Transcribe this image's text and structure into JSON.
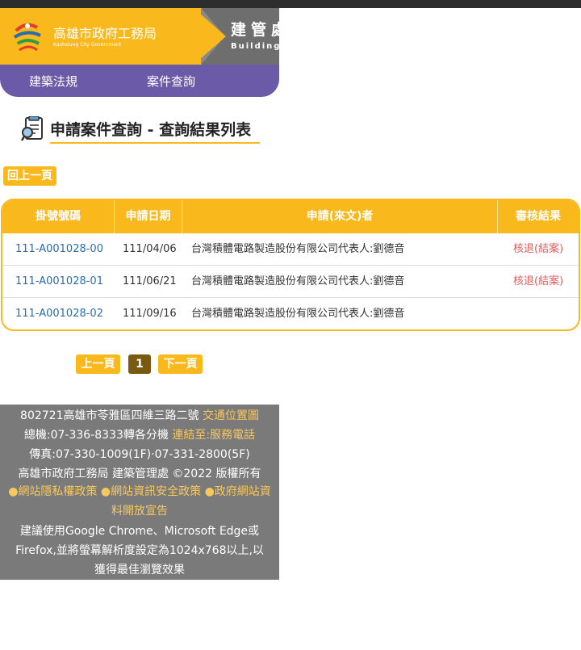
{
  "header": {
    "org_cn": "高雄市政府工務局",
    "org_en": "Kaohsiung City Government",
    "dept_cn": "建管處",
    "dept_en": "Buildings",
    "nav": [
      "建築法規",
      "案件查詢"
    ]
  },
  "page": {
    "title": "申請案件查詢 - 查詢結果列表",
    "back_label": "回上一頁"
  },
  "table": {
    "columns": [
      "掛號號碼",
      "申請日期",
      "申請(來文)者",
      "審核結果"
    ],
    "rows": [
      {
        "case_no": "111-A001028-00",
        "date": "111/04/06",
        "applicant": "台灣積體電路製造股份有限公司代表人:劉德音",
        "result": "核退(結案)"
      },
      {
        "case_no": "111-A001028-01",
        "date": "111/06/21",
        "applicant": "台灣積體電路製造股份有限公司代表人:劉德音",
        "result": "核退(結案)"
      },
      {
        "case_no": "111-A001028-02",
        "date": "111/09/16",
        "applicant": "台灣積體電路製造股份有限公司代表人:劉德音",
        "result": ""
      }
    ]
  },
  "pagination": {
    "prev_label": "上一頁",
    "current": "1",
    "next_label": "下一頁"
  },
  "footer": {
    "address": "802721高雄市苓雅區四維三路二號",
    "map_link": "交通位置圖",
    "phone": "總機:07-336-8333轉各分機",
    "phone_link": "連結至:服務電話",
    "fax": "傳真:07-330-1009(1F)·07-331-2800(5F)",
    "copyright": "高雄市政府工務局 建築管理處 ©2022 版權所有",
    "policy_1": "網站隱私權政策",
    "policy_2": "網站資訊安全政策",
    "policy_3a": "政府網站資",
    "policy_3b": "料開放宣告",
    "browser_1": "建議使用Google Chrome、Microsoft Edge或",
    "browser_2": "Firefox,並將螢幕解析度設定為1024x768以上,以",
    "browser_3": "獲得最佳瀏覽效果"
  },
  "colors": {
    "accent": "#f9b81c",
    "nav_purple": "#6a5aa8",
    "link_blue": "#2a6cb0",
    "result_red": "#e25a5a",
    "footer_gray": "#7a7a7a"
  }
}
